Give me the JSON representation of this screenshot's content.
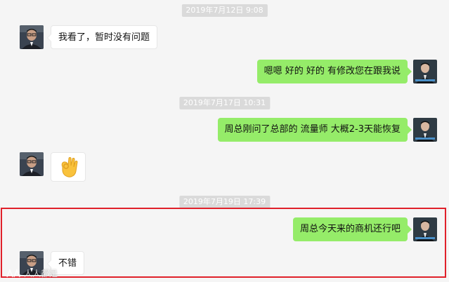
{
  "timestamps": [
    "2019年7月12日 9:08",
    "2019年7月17日 10:31",
    "2019年7月19日 17:39"
  ],
  "messages": {
    "m1": "我看了，暂时没有问题",
    "m2": "嗯嗯 好的 好的 有修改您在跟我说",
    "m3": "周总刚问了总部的 流量师 大概2-3天能恢复",
    "m4": "周总今天来的商机还行吧",
    "m5": "不错"
  },
  "emoji": {
    "name": "ok-hand-emoji"
  },
  "watermark": {
    "text": "人人都是"
  },
  "colors": {
    "sent_bubble": "#95ec69",
    "received_bubble": "#ffffff",
    "highlight_border": "#e0202a",
    "timestamp_bg": "#dadada"
  }
}
